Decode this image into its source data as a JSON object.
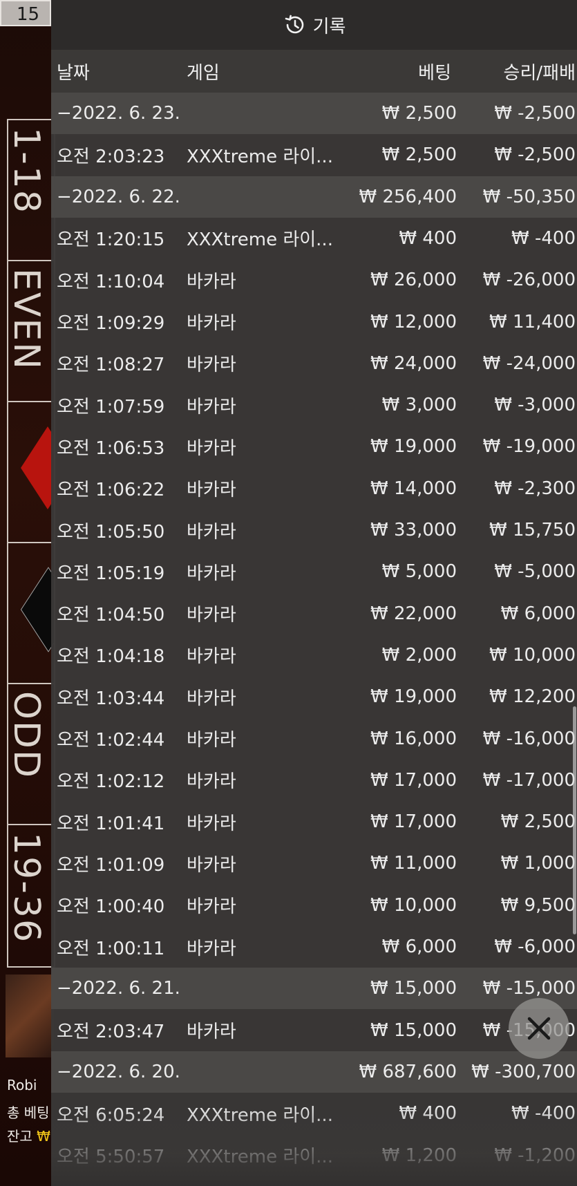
{
  "background": {
    "top_number": "15",
    "board_labels": [
      "1-18",
      "EVEN",
      "ODD",
      "19-36"
    ],
    "player_name": "Robi",
    "total_bet_label": "총 베팅",
    "balance_label": "잔고",
    "balance_currency": "₩"
  },
  "header": {
    "icon": "history-icon",
    "title": "기록"
  },
  "columns": {
    "date": "날짜",
    "game": "게임",
    "bet": "베팅",
    "result": "승리/패배"
  },
  "rows": [
    {
      "type": "date",
      "time": "−2022. 6. 23.",
      "game": "",
      "bet": "₩ 2,500",
      "result": "₩ -2,500"
    },
    {
      "type": "entry",
      "time": "오전 2:03:23",
      "game": "XXXtreme 라이...",
      "bet": "₩ 2,500",
      "result": "₩ -2,500"
    },
    {
      "type": "date",
      "time": "−2022. 6. 22.",
      "game": "",
      "bet": "₩ 256,400",
      "result": "₩ -50,350"
    },
    {
      "type": "entry",
      "time": "오전 1:20:15",
      "game": "XXXtreme 라이...",
      "bet": "₩ 400",
      "result": "₩ -400"
    },
    {
      "type": "entry",
      "time": "오전 1:10:04",
      "game": "바카라",
      "bet": "₩ 26,000",
      "result": "₩ -26,000"
    },
    {
      "type": "entry",
      "time": "오전 1:09:29",
      "game": "바카라",
      "bet": "₩ 12,000",
      "result": "₩ 11,400"
    },
    {
      "type": "entry",
      "time": "오전 1:08:27",
      "game": "바카라",
      "bet": "₩ 24,000",
      "result": "₩ -24,000"
    },
    {
      "type": "entry",
      "time": "오전 1:07:59",
      "game": "바카라",
      "bet": "₩ 3,000",
      "result": "₩ -3,000"
    },
    {
      "type": "entry",
      "time": "오전 1:06:53",
      "game": "바카라",
      "bet": "₩ 19,000",
      "result": "₩ -19,000"
    },
    {
      "type": "entry",
      "time": "오전 1:06:22",
      "game": "바카라",
      "bet": "₩ 14,000",
      "result": "₩ -2,300"
    },
    {
      "type": "entry",
      "time": "오전 1:05:50",
      "game": "바카라",
      "bet": "₩ 33,000",
      "result": "₩ 15,750"
    },
    {
      "type": "entry",
      "time": "오전 1:05:19",
      "game": "바카라",
      "bet": "₩ 5,000",
      "result": "₩ -5,000"
    },
    {
      "type": "entry",
      "time": "오전 1:04:50",
      "game": "바카라",
      "bet": "₩ 22,000",
      "result": "₩ 6,000"
    },
    {
      "type": "entry",
      "time": "오전 1:04:18",
      "game": "바카라",
      "bet": "₩ 2,000",
      "result": "₩ 10,000"
    },
    {
      "type": "entry",
      "time": "오전 1:03:44",
      "game": "바카라",
      "bet": "₩ 19,000",
      "result": "₩ 12,200"
    },
    {
      "type": "entry",
      "time": "오전 1:02:44",
      "game": "바카라",
      "bet": "₩ 16,000",
      "result": "₩ -16,000"
    },
    {
      "type": "entry",
      "time": "오전 1:02:12",
      "game": "바카라",
      "bet": "₩ 17,000",
      "result": "₩ -17,000"
    },
    {
      "type": "entry",
      "time": "오전 1:01:41",
      "game": "바카라",
      "bet": "₩ 17,000",
      "result": "₩ 2,500"
    },
    {
      "type": "entry",
      "time": "오전 1:01:09",
      "game": "바카라",
      "bet": "₩ 11,000",
      "result": "₩ 1,000"
    },
    {
      "type": "entry",
      "time": "오전 1:00:40",
      "game": "바카라",
      "bet": "₩ 10,000",
      "result": "₩ 9,500"
    },
    {
      "type": "entry",
      "time": "오전 1:00:11",
      "game": "바카라",
      "bet": "₩ 6,000",
      "result": "₩ -6,000"
    },
    {
      "type": "date",
      "time": "−2022. 6. 21.",
      "game": "",
      "bet": "₩ 15,000",
      "result": "₩ -15,000"
    },
    {
      "type": "entry",
      "time": "오전 2:03:47",
      "game": "바카라",
      "bet": "₩ 15,000",
      "result": "₩ -15,000"
    },
    {
      "type": "date",
      "time": "−2022. 6. 20.",
      "game": "",
      "bet": "₩ 687,600",
      "result": "₩ -300,700"
    },
    {
      "type": "entry",
      "time": "오전 6:05:24",
      "game": "XXXtreme 라이...",
      "bet": "₩ 400",
      "result": "₩ -400"
    },
    {
      "type": "entry",
      "time": "오전 5:50:57",
      "game": "XXXtreme 라이...",
      "bet": "₩ 1,200",
      "result": "₩ -1,200"
    }
  ],
  "close_button": {
    "icon": "close-icon"
  },
  "colors": {
    "panel_bg": "#3a3837",
    "date_row_bg": "#4a4846",
    "text": "#ececec",
    "accent_yellow": "#f0c419"
  }
}
